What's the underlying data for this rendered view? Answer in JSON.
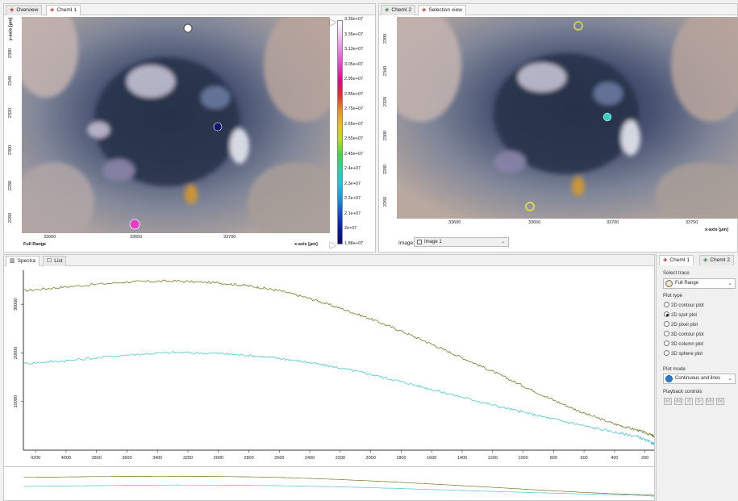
{
  "left_panel": {
    "tabs": [
      {
        "label": "Overview"
      },
      {
        "label": "ChemI 1"
      }
    ],
    "y_axis_label": "y-axis [µm]",
    "y_ticks": [
      "2390",
      "2340",
      "2320",
      "2300",
      "2280",
      "2260"
    ],
    "x_ticks": [
      "33600",
      "33650",
      "33700"
    ],
    "x_axis_label": "x-axis [µm]",
    "range_label": "Full Range"
  },
  "colorbar": {
    "labels": [
      "3.39e+07",
      "3.35e+07",
      "3.13e+07",
      "3.05e+07",
      "2.95e+07",
      "2.85e+07",
      "2.75e+07",
      "2.65e+07",
      "2.55e+07",
      "2.45e+07",
      "2.4e+07",
      "2.3e+07",
      "2.2e+07",
      "2.1e+07",
      "2e+07",
      "1.88e+07"
    ],
    "colors": [
      "#ffffff",
      "#f2c6ee",
      "#ee7de6",
      "#e83ecc",
      "#e9008c",
      "#e62a2a",
      "#f08a1c",
      "#f0c010",
      "#b6e018",
      "#3fd83f",
      "#1fd4a6",
      "#19c4e6",
      "#1494e4",
      "#1448d4",
      "#0c1aa8",
      "#0a0a6a"
    ]
  },
  "right_panel": {
    "tabs": [
      {
        "label": "ChemI 2"
      },
      {
        "label": "Selection view"
      }
    ],
    "y_ticks": [
      "2390",
      "2340",
      "2320",
      "2300",
      "2280",
      "2260"
    ],
    "x_ticks": [
      "33600",
      "33650",
      "33700",
      "33750"
    ],
    "x_axis_label": "x-axis [µm]",
    "image_label": "Image:",
    "image_value": "Image 1"
  },
  "spectra": {
    "tabs": [
      {
        "label": "Spectra"
      },
      {
        "label": "List"
      }
    ]
  },
  "chart_data": {
    "type": "line",
    "x_ticks": [
      "4200",
      "4000",
      "3800",
      "3600",
      "3400",
      "3200",
      "3000",
      "2800",
      "2600",
      "2400",
      "2200",
      "2000",
      "1800",
      "1600",
      "1400",
      "1200",
      "1000",
      "800",
      "600",
      "400",
      "200"
    ],
    "y_ticks": [
      "30000",
      "20000",
      "10000"
    ],
    "xlim": [
      4280,
      140
    ],
    "ylim": [
      0,
      37000
    ],
    "x": [
      4280,
      4000,
      3600,
      3300,
      3000,
      2800,
      2600,
      2400,
      2200,
      2000,
      1800,
      1600,
      1400,
      1200,
      1000,
      800,
      600,
      400,
      250,
      160,
      140
    ],
    "series": [
      {
        "color": "#7a7a2a",
        "values": [
          32800,
          33600,
          34600,
          34800,
          34400,
          33800,
          32800,
          31200,
          29200,
          27000,
          24500,
          21800,
          19000,
          16200,
          13200,
          10300,
          7600,
          5400,
          4100,
          3200,
          2800
        ]
      },
      {
        "color": "#4ec8d6",
        "values": [
          17800,
          18400,
          19600,
          20100,
          19900,
          19500,
          18900,
          18000,
          16900,
          15600,
          14100,
          12500,
          10900,
          9300,
          7800,
          6400,
          5000,
          3700,
          2800,
          1600,
          1200
        ]
      }
    ]
  },
  "sidebar": {
    "tabs": [
      {
        "label": "ChemI 1"
      },
      {
        "label": "ChemI 2"
      }
    ],
    "select_trace_label": "Select trace",
    "trace_value": "Full Range",
    "plot_type_label": "Plot type",
    "plot_types": [
      {
        "label": "2D contour plot",
        "selected": false
      },
      {
        "label": "2D spot plot",
        "selected": true
      },
      {
        "label": "2D pixel plot",
        "selected": false
      },
      {
        "label": "3D contour plot",
        "selected": false
      },
      {
        "label": "3D column plot",
        "selected": false
      },
      {
        "label": "3D sphere plot",
        "selected": false
      }
    ],
    "plot_mode_label": "Plot mode",
    "plot_mode_value": "Continuous and lines",
    "playback_label": "Playback controls",
    "playback_buttons": [
      "|◁",
      "◁◁",
      "◁",
      "▷",
      "▷▷",
      "▷|"
    ]
  }
}
